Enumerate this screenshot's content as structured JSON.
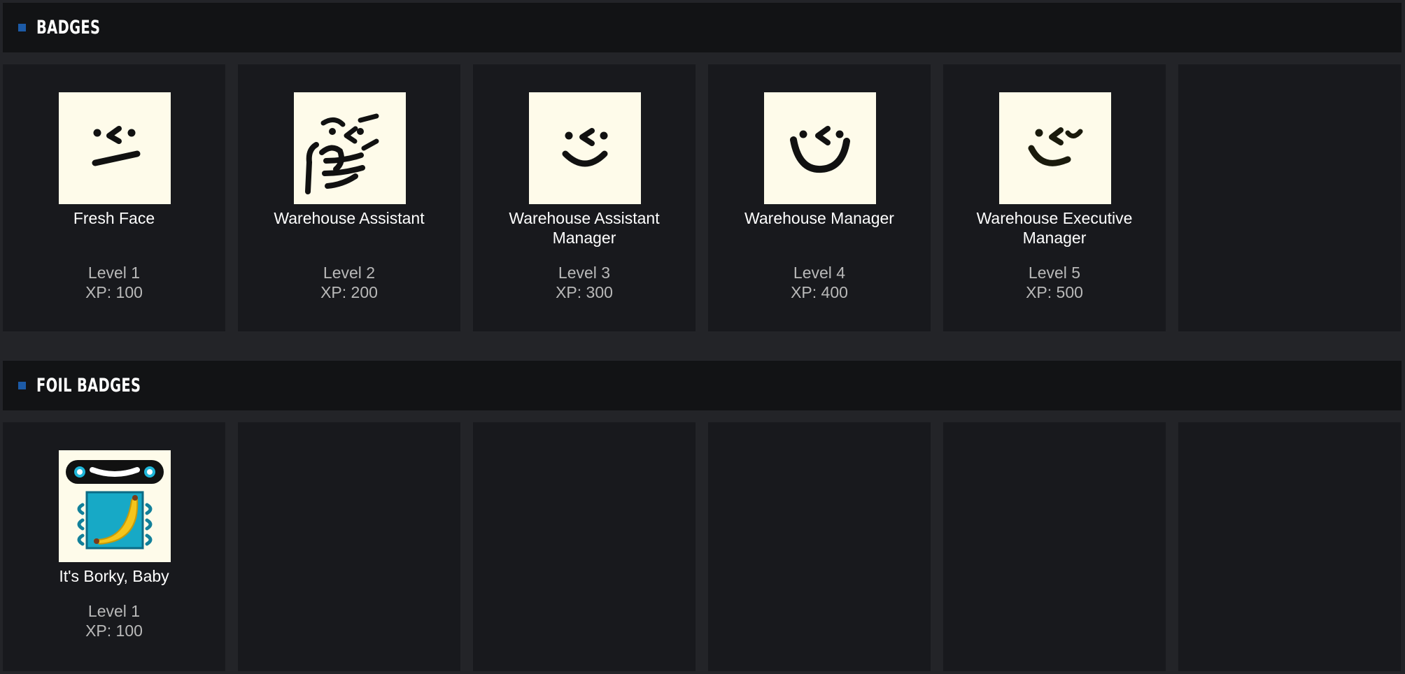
{
  "badges_section": {
    "title": "BADGES",
    "items": [
      {
        "name": "Fresh Face",
        "level": "Level 1",
        "xp": "XP: 100",
        "icon": "smirk-face-icon"
      },
      {
        "name": "Warehouse Assistant",
        "level": "Level 2",
        "xp": "XP: 200",
        "icon": "smug-face-with-hand-icon"
      },
      {
        "name": "Warehouse Assistant Manager",
        "level": "Level 3",
        "xp": "XP: 300",
        "icon": "smile-face-icon"
      },
      {
        "name": "Warehouse Manager",
        "level": "Level 4",
        "xp": "XP: 400",
        "icon": "big-smile-face-icon"
      },
      {
        "name": "Warehouse Executive Manager",
        "level": "Level 5",
        "xp": "XP: 500",
        "icon": "wink-smile-face-icon"
      }
    ]
  },
  "foil_section": {
    "title": "FOIL BADGES",
    "items": [
      {
        "name": "It's Borky, Baby",
        "level": "Level 1",
        "xp": "XP: 100",
        "icon": "banana-robot-icon"
      }
    ]
  },
  "colors": {
    "background": "#232428",
    "header": "#121315",
    "card": "#18191d",
    "marker": "#1c5aa6",
    "badge_bg": "#fefbea"
  }
}
